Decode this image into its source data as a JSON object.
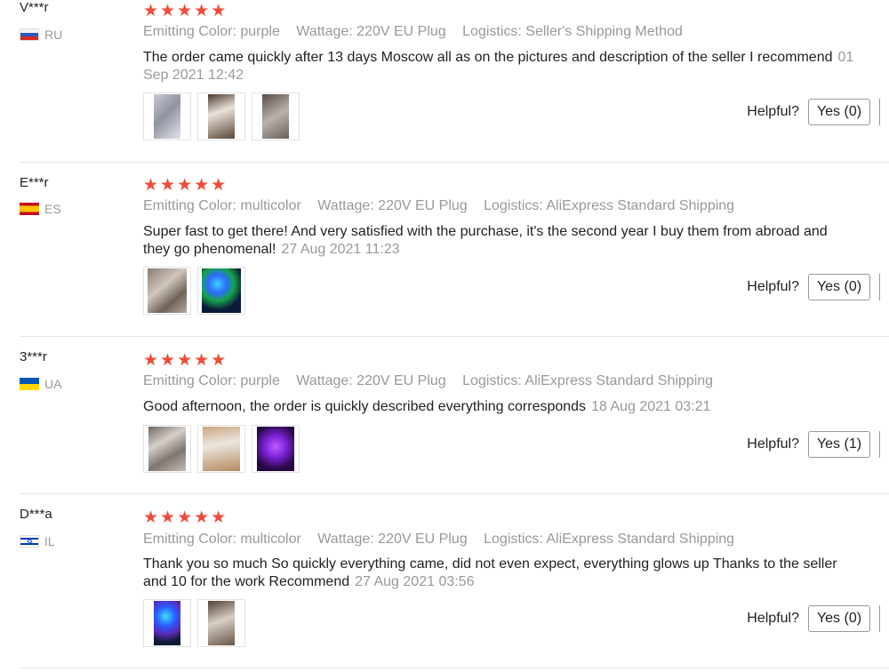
{
  "helpful_label": "Helpful?",
  "rating_stars": "★★★★★",
  "reviews": [
    {
      "user": "V***r",
      "country": "RU",
      "rating": 5,
      "color": "Emitting Color: purple",
      "wattage": "Wattage: 220V EU Plug",
      "logistics": "Logistics: Seller's Shipping Method",
      "text": "The order came quickly after 13 days Moscow all as on the pictures and description of the seller I recommend",
      "date": "01 Sep 2021 12:42",
      "yes_label": "Yes (0)"
    },
    {
      "user": "E***r",
      "country": "ES",
      "rating": 5,
      "color": "Emitting Color: multicolor",
      "wattage": "Wattage: 220V EU Plug",
      "logistics": "Logistics: AliExpress Standard Shipping",
      "text": "Super fast to get there! And very satisfied with the purchase, it's the second year I buy them from abroad and they go phenomenal!",
      "date": "27 Aug 2021 11:23",
      "yes_label": "Yes (0)"
    },
    {
      "user": "3***r",
      "country": "UA",
      "rating": 5,
      "color": "Emitting Color: purple",
      "wattage": "Wattage: 220V EU Plug",
      "logistics": "Logistics: AliExpress Standard Shipping",
      "text": "Good afternoon, the order is quickly described everything corresponds",
      "date": "18 Aug 2021 03:21",
      "yes_label": "Yes (1)"
    },
    {
      "user": "D***a",
      "country": "IL",
      "rating": 5,
      "color": "Emitting Color: multicolor",
      "wattage": "Wattage: 220V EU Plug",
      "logistics": "Logistics: AliExpress Standard Shipping",
      "text": "Thank you so much So quickly everything came, did not even expect, everything glows up Thanks to the seller and 10 for the work Recommend",
      "date": "27 Aug 2021 03:56",
      "yes_label": "Yes (0)"
    }
  ],
  "colors": {
    "star": "#f04b3a",
    "muted_text": "#999999",
    "divider": "#e5e5e5"
  }
}
